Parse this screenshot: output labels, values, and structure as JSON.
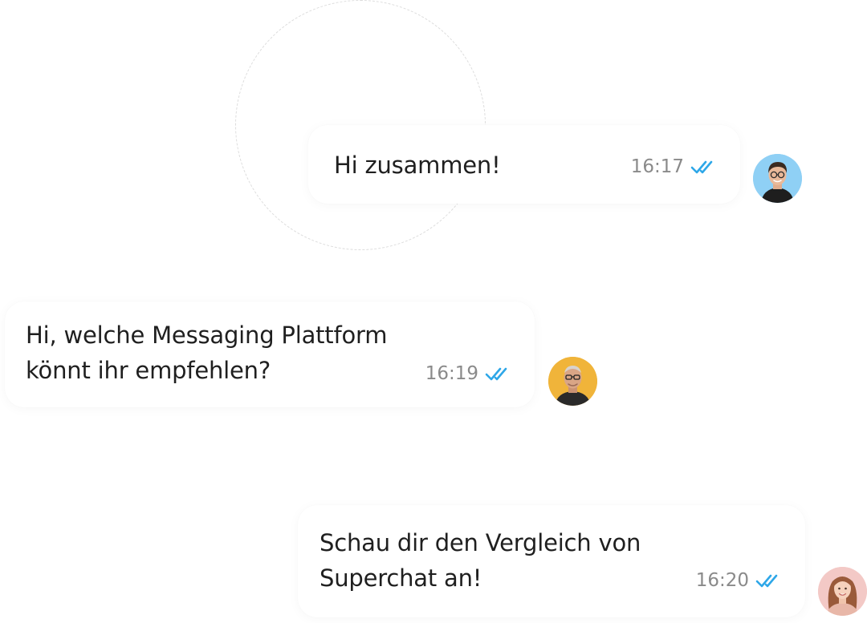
{
  "conversation": {
    "messages": [
      {
        "text": "Hi zusammen!",
        "time": "16:17",
        "status_icon": "double-check-icon",
        "avatar_icon": "man-with-glasses-avatar"
      },
      {
        "text": "Hi, welche Messaging Plattform\nkönnt ihr empfehlen?",
        "time": "16:19",
        "status_icon": "double-check-icon",
        "avatar_icon": "bald-man-with-glasses-avatar"
      },
      {
        "text": "Schau dir den Vergleich von\nSuperchat an!",
        "time": "16:20",
        "status_icon": "double-check-icon",
        "avatar_icon": "woman-avatar"
      }
    ]
  },
  "colors": {
    "read_check": "#2ea7e8",
    "time_text": "#8a8a8a",
    "message_text": "#1f1f1f",
    "avatar1_bg": "#8fd0f5",
    "avatar2_bg": "#f0b43a",
    "avatar3_bg": "#f3c9c6"
  }
}
